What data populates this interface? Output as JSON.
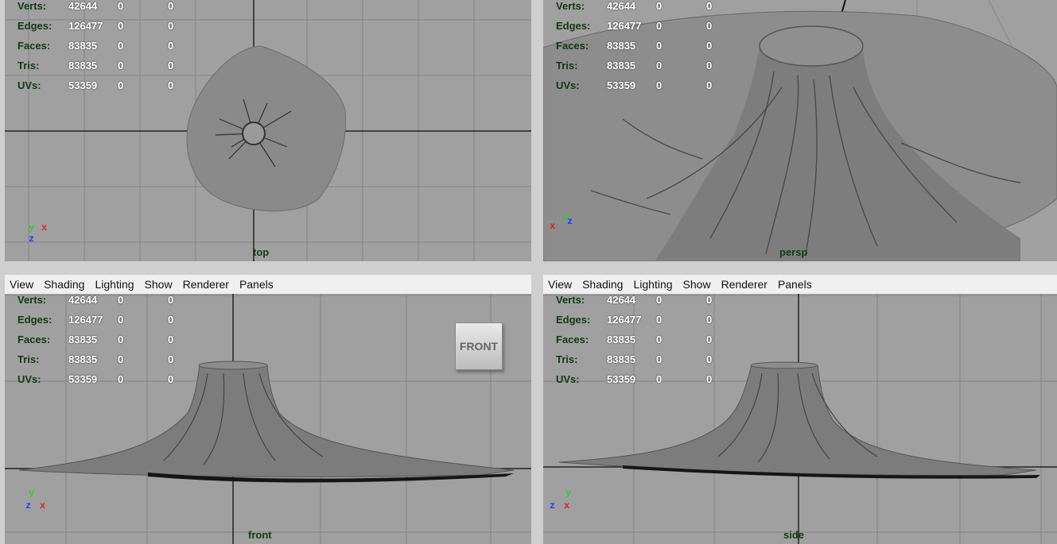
{
  "menu": [
    "View",
    "Shading",
    "Lighting",
    "Show",
    "Renderer",
    "Panels"
  ],
  "stats": [
    {
      "label": "Verts:",
      "v1": "42644",
      "v2": "0",
      "v3": "0"
    },
    {
      "label": "Edges:",
      "v1": "126477",
      "v2": "0",
      "v3": "0"
    },
    {
      "label": "Faces:",
      "v1": "83835",
      "v2": "0",
      "v3": "0"
    },
    {
      "label": "Tris:",
      "v1": "83835",
      "v2": "0",
      "v3": "0"
    },
    {
      "label": "UVs:",
      "v1": "53359",
      "v2": "0",
      "v3": "0"
    }
  ],
  "viewports": {
    "top": {
      "camera": "top"
    },
    "persp": {
      "camera": "persp"
    },
    "front": {
      "camera": "front",
      "viewcube": "FRONT"
    },
    "side": {
      "camera": "side"
    }
  },
  "colors": {
    "viewport_bg": "#a0a0a0",
    "grid": "#7e7e7e",
    "axis": "#202020",
    "hud_label": "#113a11"
  }
}
